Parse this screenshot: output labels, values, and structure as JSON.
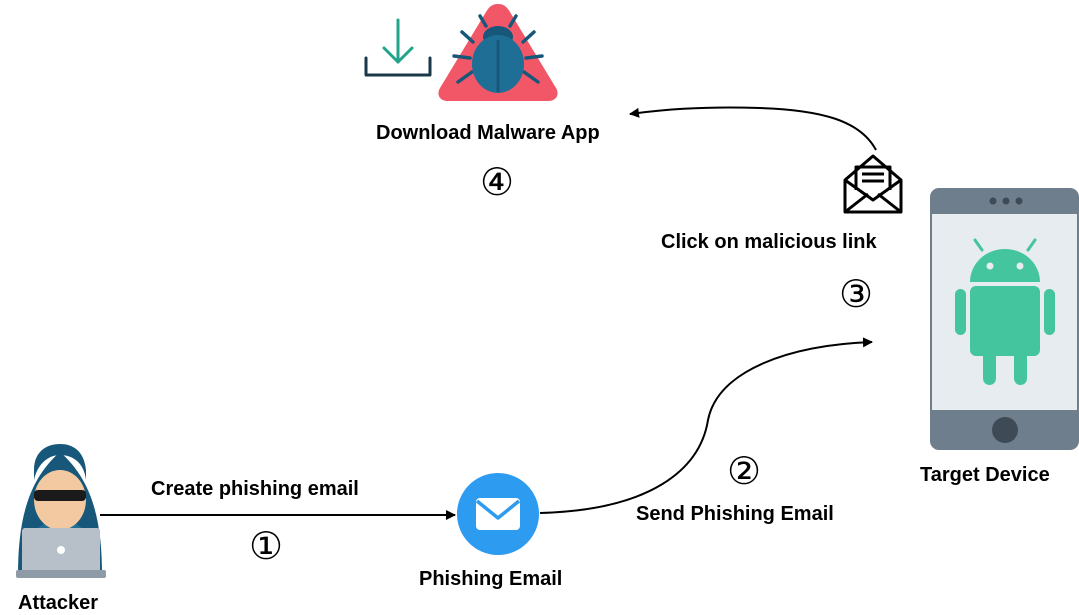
{
  "nodes": {
    "attacker": {
      "label": "Attacker"
    },
    "phishing_email": {
      "label": "Phishing Email"
    },
    "target_device": {
      "label": "Target Device"
    },
    "malware_app": {
      "label": "Download Malware App"
    }
  },
  "steps": [
    {
      "number": "①",
      "label": "Create phishing email"
    },
    {
      "number": "②",
      "label": "Send Phishing Email"
    },
    {
      "number": "③",
      "label": "Click on malicious link"
    },
    {
      "number": "④",
      "label": "Download Malware App"
    }
  ],
  "icons": {
    "attacker": "hacker-icon",
    "phishing_email": "envelope-icon",
    "target_device": "android-phone-icon",
    "malicious_link": "open-mail-icon",
    "download": "download-icon",
    "malware": "bug-warning-icon"
  },
  "colors": {
    "email_blue": "#2D9BF0",
    "android_green": "#45C59E",
    "phone_gray": "#6F7E8C",
    "warning_red": "#F25767",
    "bug_teal": "#17587A",
    "download_teal": "#20A48A"
  }
}
